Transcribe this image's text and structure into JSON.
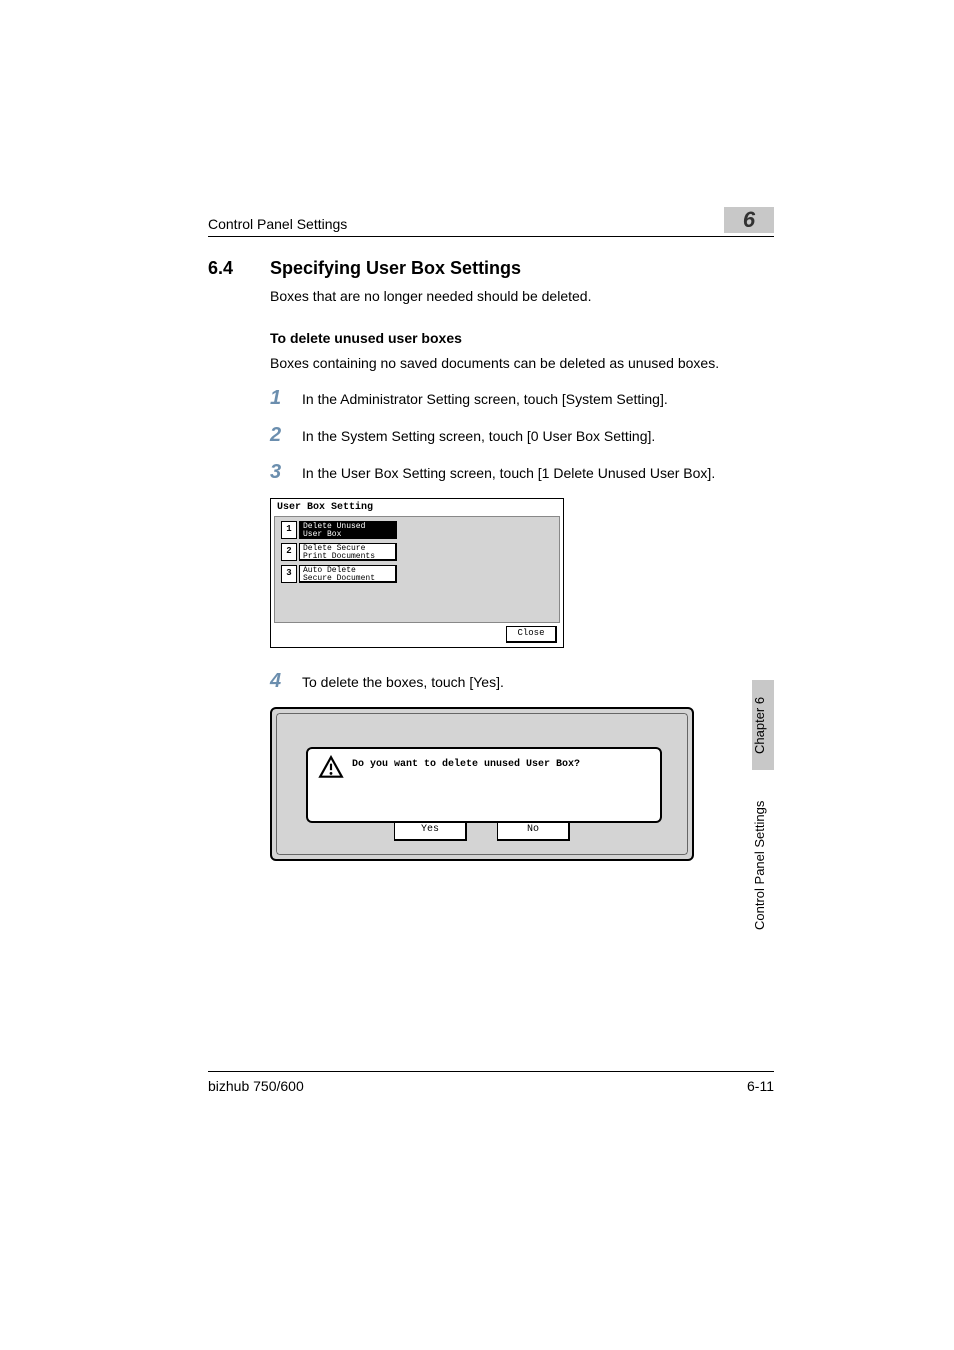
{
  "header": {
    "running_title": "Control Panel Settings",
    "chapter_number": "6"
  },
  "section": {
    "number": "6.4",
    "title": "Specifying User Box Settings",
    "intro": "Boxes that are no longer needed should be deleted."
  },
  "subsection": {
    "title": "To delete unused user boxes",
    "intro": "Boxes containing no saved documents can be deleted as unused boxes."
  },
  "steps": {
    "s1": "In the Administrator Setting screen, touch [System Setting].",
    "s2": "In the System Setting screen, touch [0 User Box Setting].",
    "s3": "In the User Box Setting screen, touch [1 Delete Unused User Box].",
    "s4": "To delete the boxes, touch [Yes]."
  },
  "step_numbers": {
    "n1": "1",
    "n2": "2",
    "n3": "3",
    "n4": "4"
  },
  "panel1": {
    "title": "User Box Setting",
    "items": {
      "i1": {
        "num": "1",
        "line1": "Delete Unused",
        "line2": "User Box"
      },
      "i2": {
        "num": "2",
        "line1": "Delete Secure",
        "line2": "Print Documents"
      },
      "i3": {
        "num": "3",
        "line1": "Auto Delete",
        "line2": "Secure Document"
      }
    },
    "close": "Close"
  },
  "panel2": {
    "message": "Do you want to delete unused User Box?",
    "yes": "Yes",
    "no": "No"
  },
  "side": {
    "chapter": "Chapter 6",
    "section": "Control Panel Settings"
  },
  "footer": {
    "product": "bizhub 750/600",
    "page": "6-11"
  }
}
